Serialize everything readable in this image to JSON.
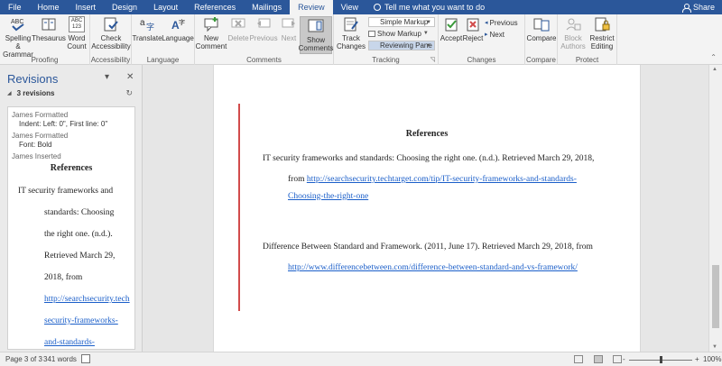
{
  "ribbon_tabs": [
    "File",
    "Home",
    "Insert",
    "Design",
    "Layout",
    "References",
    "Mailings",
    "Review",
    "View"
  ],
  "tell_me": "Tell me what you want to do",
  "share": "Share",
  "groups": {
    "proofing": {
      "label": "Proofing",
      "spelling": "Spelling & Grammar",
      "thesaurus": "Thesaurus",
      "word_count": "Word Count",
      "wc_icon": "ABC 123"
    },
    "accessibility": {
      "label": "Accessibility",
      "check": "Check Accessibility"
    },
    "language": {
      "label": "Language",
      "translate": "Translate",
      "language": "Language"
    },
    "comments": {
      "label": "Comments",
      "new": "New Comment",
      "delete": "Delete",
      "previous": "Previous",
      "next": "Next",
      "show": "Show Comments"
    },
    "tracking": {
      "label": "Tracking",
      "track": "Track Changes",
      "markup": "Simple Markup",
      "show_markup": "Show Markup",
      "reviewing_pane": "Reviewing Pane"
    },
    "changes": {
      "label": "Changes",
      "accept": "Accept",
      "reject": "Reject",
      "previous": "Previous",
      "next": "Next"
    },
    "compare": {
      "label": "Compare",
      "compare": "Compare"
    },
    "protect": {
      "label": "Protect",
      "block": "Block Authors",
      "restrict": "Restrict Editing"
    }
  },
  "pane": {
    "title": "Revisions",
    "count": "3 revisions",
    "revisions": [
      {
        "author": "James Formatted",
        "detail": "Indent: Left:  0\", First line:  0\""
      },
      {
        "author": "James Formatted",
        "detail": "Font: Bold"
      },
      {
        "author": "James Inserted",
        "detail": "References"
      }
    ],
    "body_lines": [
      "IT security frameworks and",
      "standards: Choosing",
      "the right one. (n.d.).",
      "Retrieved March 29,",
      "2018, from"
    ],
    "link_lines": [
      "http://searchsecurity.tech",
      "security-frameworks-",
      "and-standards-"
    ]
  },
  "document": {
    "heading": "References",
    "ref1_line1": "IT security frameworks and standards: Choosing the right one. (n.d.). Retrieved March 29, 2018,",
    "ref1_from": "from",
    "ref1_link1": "http://searchsecurity.techtarget.com/tip/IT-security-frameworks-and-standards-",
    "ref1_link2": "Choosing-the-right-one",
    "ref2_line1": "Difference Between Standard and Framework. (2011, June 17). Retrieved March 29, 2018, from",
    "ref2_link": "http://www.differencebetween.com/difference-between-standard-and-vs-framework/"
  },
  "status": {
    "page": "Page 3 of 3",
    "words": "341 words",
    "zoom_minus": "-",
    "zoom_plus": "+",
    "zoom": "100%"
  }
}
